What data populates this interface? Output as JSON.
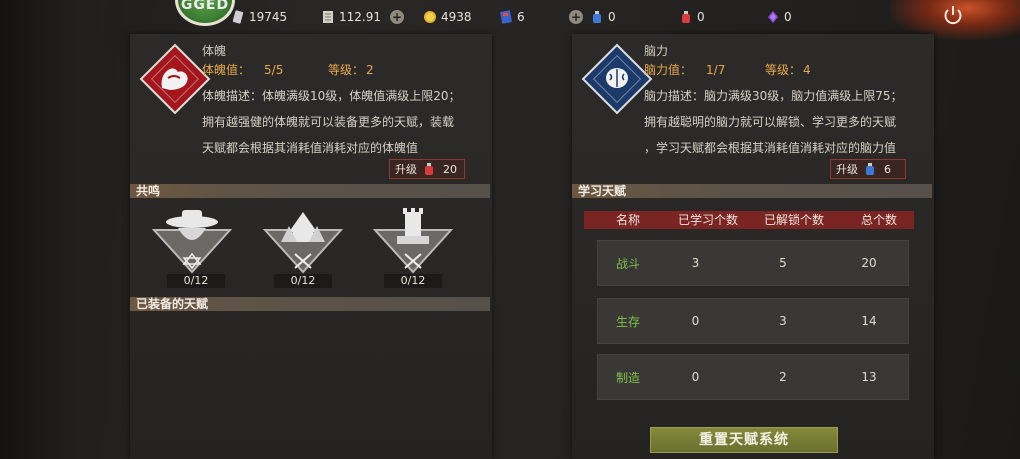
{
  "topbar": {
    "level_text": "GGED",
    "resources": [
      {
        "icon": "ticket-icon",
        "value": "19745"
      },
      {
        "icon": "cash-icon",
        "value": "112.91"
      },
      {
        "icon": "gold-coin-icon",
        "value": "4938"
      },
      {
        "icon": "blue-card-icon",
        "value": "6"
      },
      {
        "icon": "blue-potion-icon",
        "value": "0"
      },
      {
        "icon": "red-potion-icon",
        "value": "0"
      },
      {
        "icon": "purple-crystal-icon",
        "value": "0"
      }
    ],
    "colors": {
      "accent_gold": "#e7a84a",
      "header_red": "#7a2424",
      "green_text": "#7fbf4a"
    }
  },
  "physique": {
    "title": "体魄",
    "value_label": "体魄值：",
    "value": "5/5",
    "level_label": "等级：",
    "level": "2",
    "desc_lines": [
      "体魄描述：体魄满级10级，体魄值满级上限20；",
      "拥有越强健的体魄就可以装备更多的天赋，装载",
      "天赋都会根据其消耗值消耗对应的体魄值"
    ],
    "upgrade_label": "升级",
    "upgrade_cost": "20"
  },
  "resonance": {
    "header": "共鸣",
    "emblems": [
      {
        "name": "bandit-emblem",
        "count": "0/12"
      },
      {
        "name": "forest-emblem",
        "count": "0/12"
      },
      {
        "name": "tower-emblem",
        "count": "0/12"
      }
    ]
  },
  "equipped": {
    "header": "已装备的天赋"
  },
  "brain": {
    "title": "脑力",
    "value_label": "脑力值：",
    "value": "1/7",
    "level_label": "等级：",
    "level": "4",
    "desc_lines": [
      "脑力描述：脑力满级30级，脑力值满级上限75；",
      "拥有越聪明的脑力就可以解锁、学习更多的天赋",
      "，学习天赋都会根据其消耗值消耗对应的脑力值"
    ],
    "upgrade_label": "升级",
    "upgrade_cost": "6"
  },
  "learn": {
    "header": "学习天赋",
    "columns": [
      "名称",
      "已学习个数",
      "已解锁个数",
      "总个数"
    ],
    "rows": [
      {
        "name": "战斗",
        "learned": "3",
        "unlocked": "5",
        "total": "20"
      },
      {
        "name": "生存",
        "learned": "0",
        "unlocked": "3",
        "total": "14"
      },
      {
        "name": "制造",
        "learned": "0",
        "unlocked": "2",
        "total": "13"
      }
    ]
  },
  "reset_button": "重置天赋系统"
}
